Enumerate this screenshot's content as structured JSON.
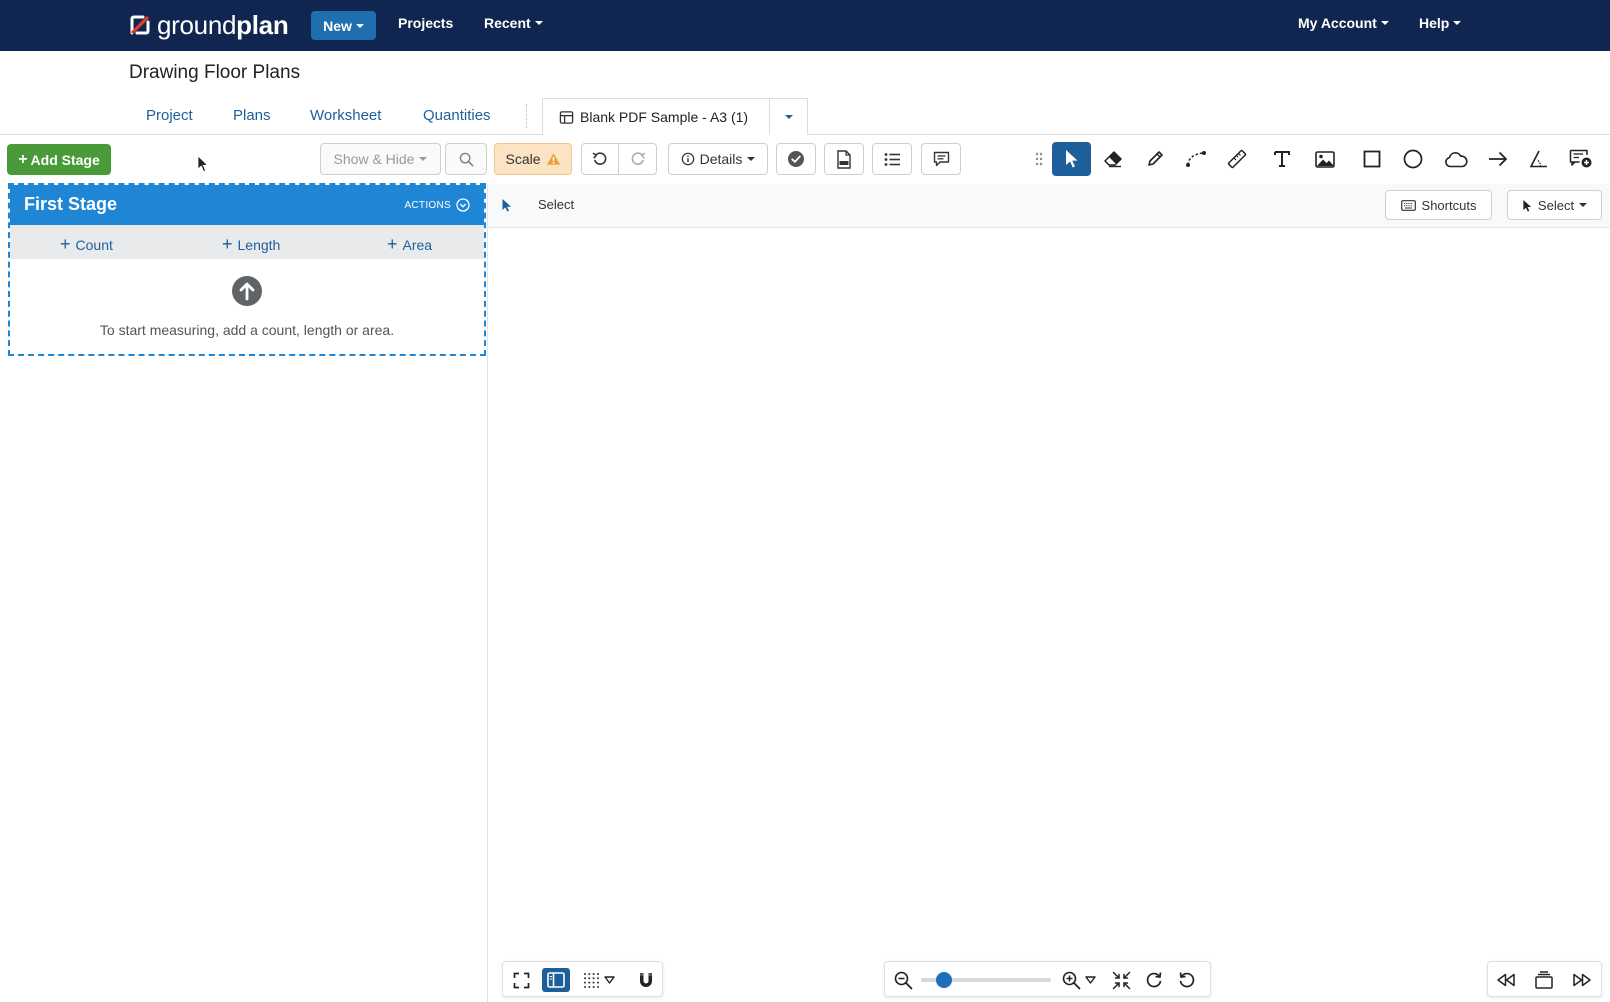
{
  "nav": {
    "logo_light": "ground",
    "logo_bold": "plan",
    "new_label": "New",
    "projects_label": "Projects",
    "recent_label": "Recent",
    "account_label": "My Account",
    "help_label": "Help"
  },
  "page": {
    "title": "Drawing Floor Plans",
    "tabs": [
      "Project",
      "Plans",
      "Worksheet",
      "Quantities"
    ],
    "plan_tab_label": "Blank PDF Sample - A3 (1)"
  },
  "toolbar": {
    "add_stage": "Add Stage",
    "show_hide": "Show & Hide",
    "scale": "Scale",
    "details": "Details"
  },
  "stage": {
    "title": "First Stage",
    "actions": "ACTIONS",
    "count": "Count",
    "length": "Length",
    "area": "Area",
    "empty_message": "To start measuring, add a count, length or area."
  },
  "canvas": {
    "mode_label": "Select",
    "shortcuts": "Shortcuts",
    "select_mode": "Select"
  },
  "zoom": {
    "level": 0.18
  },
  "colors": {
    "nav_bg": "#10254f",
    "primary": "#1d5f9a",
    "stage_blue": "#1f86d6",
    "add_green": "#4a9a3a",
    "scale_warn": "#fbe3c3"
  }
}
